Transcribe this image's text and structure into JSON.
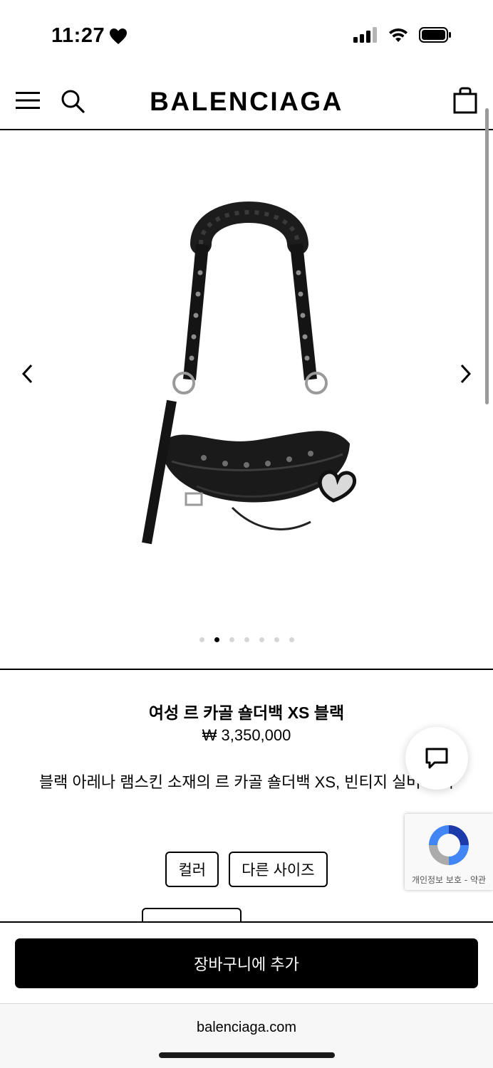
{
  "status_bar": {
    "time": "11:27",
    "icons": [
      "heart-icon",
      "cellular-signal-icon",
      "wifi-icon",
      "battery-icon"
    ]
  },
  "header": {
    "brand": "BALENCIAGA",
    "icons": [
      "menu-icon",
      "search-icon",
      "shopping-bag-icon"
    ]
  },
  "gallery": {
    "image_count": 7,
    "active_index": 1,
    "icons": [
      "chevron-left-icon",
      "chevron-right-icon"
    ]
  },
  "product": {
    "title": "여성 르 카골 숄더백 XS 블랙",
    "price": "₩ 3,350,000",
    "description": "블랙 아레나 램스킨 소재의 르 카골 숄더백 XS, 빈티지 실버 장식"
  },
  "options": {
    "color_label": "컬러",
    "other_sizes_label": "다른 사이즈"
  },
  "recaptcha": {
    "text": "개인정보 보호 - 약관"
  },
  "cta": {
    "add_to_cart": "장바구니에 추가"
  },
  "browser": {
    "url": "balenciaga.com"
  },
  "colors": {
    "accent": "#000000",
    "background": "#ffffff",
    "dot_inactive": "#d6d6d6"
  }
}
